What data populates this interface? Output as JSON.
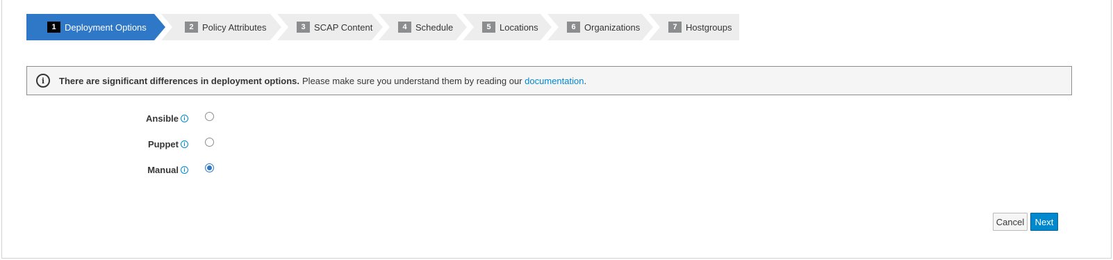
{
  "wizard": {
    "steps": [
      {
        "num": "1",
        "label": "Deployment Options"
      },
      {
        "num": "2",
        "label": "Policy Attributes"
      },
      {
        "num": "3",
        "label": "SCAP Content"
      },
      {
        "num": "4",
        "label": "Schedule"
      },
      {
        "num": "5",
        "label": "Locations"
      },
      {
        "num": "6",
        "label": "Organizations"
      },
      {
        "num": "7",
        "label": "Hostgroups"
      }
    ],
    "active_index": 0
  },
  "alert": {
    "icon": "info-icon",
    "strong": "There are significant differences in deployment options.",
    "text": "Please make sure you understand them by reading our",
    "link": "documentation",
    "period": "."
  },
  "options": [
    {
      "label": "Ansible",
      "checked": false
    },
    {
      "label": "Puppet",
      "checked": false
    },
    {
      "label": "Manual",
      "checked": true
    }
  ],
  "buttons": {
    "cancel": "Cancel",
    "next": "Next"
  },
  "colors": {
    "accent": "#2e78c7",
    "link": "#0088ce"
  }
}
